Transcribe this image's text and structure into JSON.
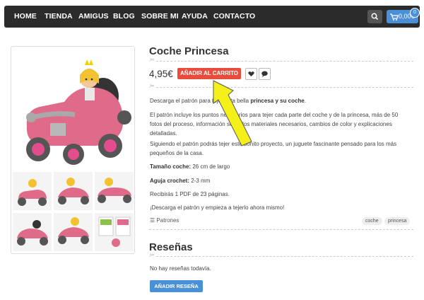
{
  "nav": {
    "items": [
      "HOME",
      "TIENDA",
      "AMIGUS",
      "BLOG",
      "SOBRE MI",
      "AYUDA",
      "CONTACTO"
    ],
    "cart_total": "0,00€",
    "cart_count": "0"
  },
  "product": {
    "title": "Coche Princesa",
    "price": "4,95€",
    "add_to_cart_label": "AÑADIR AL CARRITO",
    "description": [
      {
        "parts": [
          "Descarga el patrón pa",
          "ra tejer esta bella ",
          "princesa y su coche",
          "."
        ]
      },
      {
        "text": "El patrón incluye los puntos necesarios para tejer cada parte del coche y de la princesa, más de 50 fotos del proceso, información sobre los materiales necesarios, cambios de color y explicaciones detalladas."
      },
      {
        "text": "Siguiendo el patrón podrás tejer este bonito proyecto, un juguete fascinante pensado para los más pequeños de la casa."
      },
      {
        "label": "Tamaño coche:",
        "value": " 26 cm de largo"
      },
      {
        "label": "Aguja crochet:",
        "value": " 2-3 mm"
      },
      {
        "text": "Recibirás 1 PDF de 23 páginas."
      },
      {
        "text": "¡Descarga el patrón y empieza a tejerlo ahora mismo!"
      }
    ],
    "category": "Patrones",
    "tags": [
      "coche",
      "princesa"
    ]
  },
  "reviews": {
    "title": "Reseñas",
    "empty_text": "No hay reseñas todavía.",
    "add_review_label": "AÑADIR RESEÑA"
  },
  "colors": {
    "nav_bg": "#2b2b2b",
    "accent_blue": "#4a90d9",
    "add_to_cart_red": "#e74c3c",
    "arrow_yellow": "#f5ef1a",
    "car_pink": "#e06a8a",
    "car_grey": "#a9a9a9"
  }
}
